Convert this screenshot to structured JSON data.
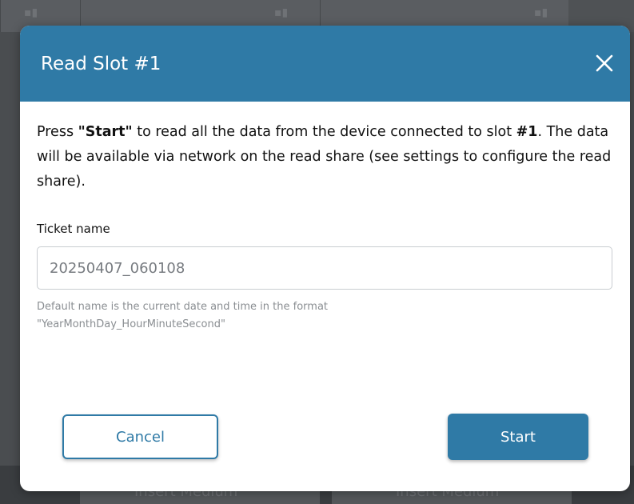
{
  "dialog": {
    "title": "Read Slot #1",
    "close_icon": "close-icon",
    "message": {
      "part1": "Press ",
      "start_emph": "\"Start\"",
      "part2": " to read all the data from the device connected to slot ",
      "slot_emph": "#1",
      "part3": ". The data will be available via network on the read share (see settings to configure the read share)."
    },
    "ticket_field": {
      "label": "Ticket name",
      "placeholder": "20250407_060108",
      "value": ""
    },
    "hint_line1": "Default name is the current date and time in the format",
    "hint_line2": "\"YearMonthDay_HourMinuteSecond\"",
    "cancel_label": "Cancel",
    "start_label": "Start"
  },
  "background": {
    "slot_labels": [
      "Insert Medium",
      "Insert Medium"
    ]
  },
  "colors": {
    "accent": "#2f7aa6",
    "overlay": "#4a4d50"
  }
}
